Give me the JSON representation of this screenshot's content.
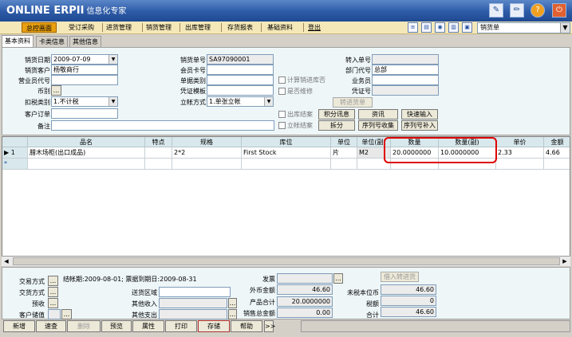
{
  "app": {
    "logo": "ONLINE ERPII",
    "subtitle": "信息化专家"
  },
  "top_icons": [
    "edit-icon",
    "pencil-icon",
    "help-icon",
    "power-icon"
  ],
  "menu": [
    {
      "label": "总控画面",
      "active": true
    },
    {
      "label": "受订采购"
    },
    {
      "label": "进货管理"
    },
    {
      "label": "销货管理"
    },
    {
      "label": "出库管理"
    },
    {
      "label": "存货报表"
    },
    {
      "label": "基础资料"
    },
    {
      "label": "登出"
    }
  ],
  "doc_type": "销货单",
  "tabs": [
    "基本资料",
    "卡类信息",
    "其他信息"
  ],
  "form": {
    "col1": {
      "sale_date_label": "销货日期",
      "sale_date": "2009-07-09",
      "customer_label": "销货客户",
      "customer": "杨敬商行",
      "salesrep_label": "营业员代号",
      "salesrep": "",
      "currency_label": "币别",
      "currency": "",
      "tax_label": "扣税类别",
      "tax": "1.不计税",
      "order_label": "客户订单",
      "order": "",
      "remark_label": "备注",
      "remark": ""
    },
    "col2": {
      "sale_no_label": "销货单号",
      "sale_no": "SA97090001",
      "member_label": "会员卡号",
      "member": "",
      "doc_cat_label": "单据类别",
      "doc_cat": "",
      "voucher_tpl_label": "凭证模板",
      "voucher_tpl": "",
      "account_label": "立帐方式",
      "account": "1.单张立帐",
      "chk1": "计算销进库否",
      "chk2": "是否维修",
      "chk3": "出库结案",
      "chk4": "立帐结案"
    },
    "col3": {
      "transfer_label": "转入单号",
      "transfer": "",
      "dept_label": "部门代号",
      "dept": "总部",
      "staff_label": "业务员",
      "staff": "",
      "voucher_label": "凭证号",
      "voucher": ""
    },
    "buttons": {
      "transfer_in": "转进货单",
      "points": "积分讯息",
      "info": "资讯",
      "quick_input": "快速输入",
      "split": "拆分",
      "serial_collect": "序列号收集",
      "serial_input": "序列号补入"
    }
  },
  "grid": {
    "columns": [
      "品名",
      "特点",
      "规格",
      "库位",
      "单位",
      "单位(副)",
      "数量",
      "数量(副)",
      "单价",
      "金额"
    ],
    "rows": [
      {
        "marker": "▶ 1",
        "name": "腊木场柜(出口成品)",
        "feature": "",
        "spec": "2*2",
        "location": "First Stock",
        "unit": "片",
        "unit_sub": "M2",
        "qty": "20.0000000",
        "qty_sub": "10.0000000",
        "price": "2.33",
        "amount": "4.66"
      }
    ],
    "new_row_marker": "*"
  },
  "bottom": {
    "trade_mode_label": "交易方式",
    "pay_terms": "结帐期:2009-08-01; 票据到期日:2009-08-31",
    "delivery_mode_label": "交货方式",
    "delivery_area_label": "送货区域",
    "prepay_label": "预收",
    "other_income_label": "其他收入",
    "customer_value_label": "客户储值",
    "other_expense_label": "其他支出",
    "invoice_label": "发票",
    "fc_amount_label": "外币金额",
    "fc_amount": "46.60",
    "product_total_label": "产品合计",
    "product_total": "20.0000000",
    "sales_total_label": "销售总金额",
    "sales_total": "0.00",
    "borrow_button": "借入转进货",
    "untaxed_label": "未税本位币",
    "untaxed": "46.60",
    "tax_amount_label": "税额",
    "tax_amount": "0",
    "total_label": "合计",
    "total": "46.60"
  },
  "actions": [
    "新增",
    "速查",
    "删除",
    "预览",
    "属性",
    "打印",
    "存储",
    "帮助",
    ">>"
  ]
}
